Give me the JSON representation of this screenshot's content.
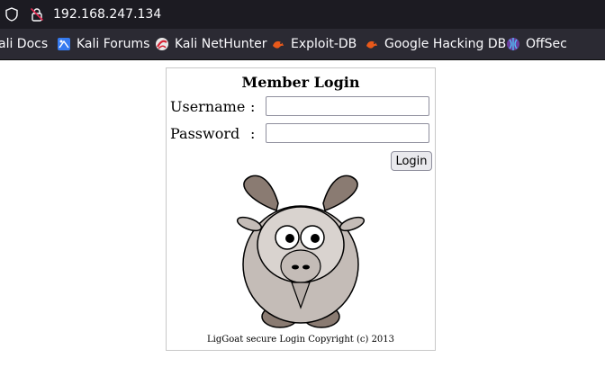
{
  "browser": {
    "url": "192.168.247.134",
    "bookmarks": [
      {
        "label": "ali Docs",
        "icon": "kali-docs-icon"
      },
      {
        "label": "Kali Forums",
        "icon": "kali-forums-icon"
      },
      {
        "label": "Kali NetHunter",
        "icon": "kali-nethunter-icon"
      },
      {
        "label": "Exploit-DB",
        "icon": "exploit-db-icon"
      },
      {
        "label": "Google Hacking DB",
        "icon": "google-hacking-db-icon"
      },
      {
        "label": "OffSec",
        "icon": "offsec-icon"
      }
    ]
  },
  "login": {
    "title": "Member Login",
    "username_label": "Username",
    "password_label": "Password",
    "colon": ":",
    "username_value": "",
    "password_value": "",
    "button_label": "Login",
    "copyright": "LigGoat secure Login Copyright (c) 2013"
  },
  "colors": {
    "urlbar_bg": "#1c1b22",
    "toolbar_bg": "#2b2a33",
    "text_light": "#fbfbfe"
  }
}
